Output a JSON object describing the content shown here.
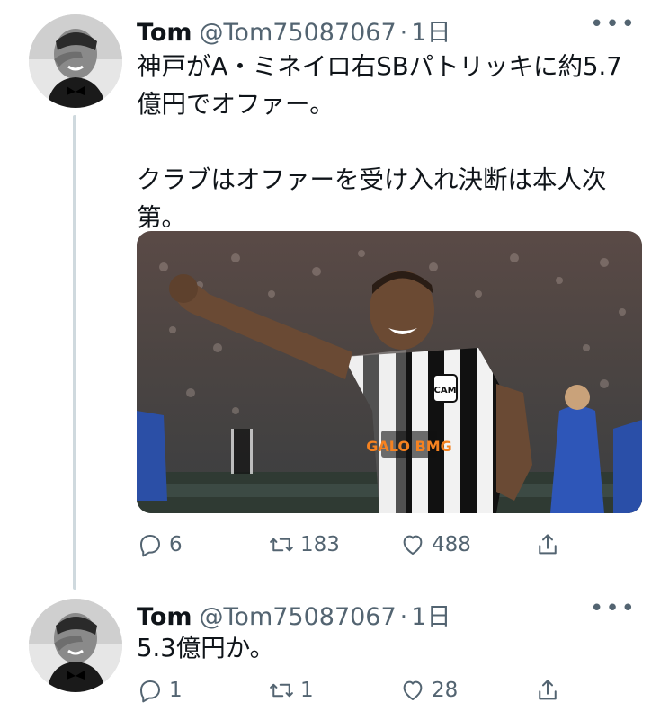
{
  "tweets": [
    {
      "name": "Tom",
      "handle": "@Tom75087067",
      "separator": "·",
      "time": "1日",
      "more": "•••",
      "text": "神戸がA・ミネイロ右SBパトリッキに約5.7億円でオファー。\n\nクラブはオファーを受け入れ決断は本人次第。",
      "has_media": true,
      "media_jersey_text": "GALO BMG",
      "media_badge": "CAM",
      "replies": "6",
      "retweets": "183",
      "likes": "488"
    },
    {
      "name": "Tom",
      "handle": "@Tom75087067",
      "separator": "·",
      "time": "1日",
      "more": "•••",
      "text": "5.3億円か。",
      "replies": "1",
      "retweets": "1",
      "likes": "28"
    }
  ],
  "icons": {
    "reply": "reply-icon",
    "retweet": "retweet-icon",
    "like": "heart-icon",
    "share": "share-icon",
    "more": "more-icon"
  },
  "colors": {
    "text": "#0f1419",
    "muted": "#536471",
    "thread_line": "#cfd9de"
  }
}
